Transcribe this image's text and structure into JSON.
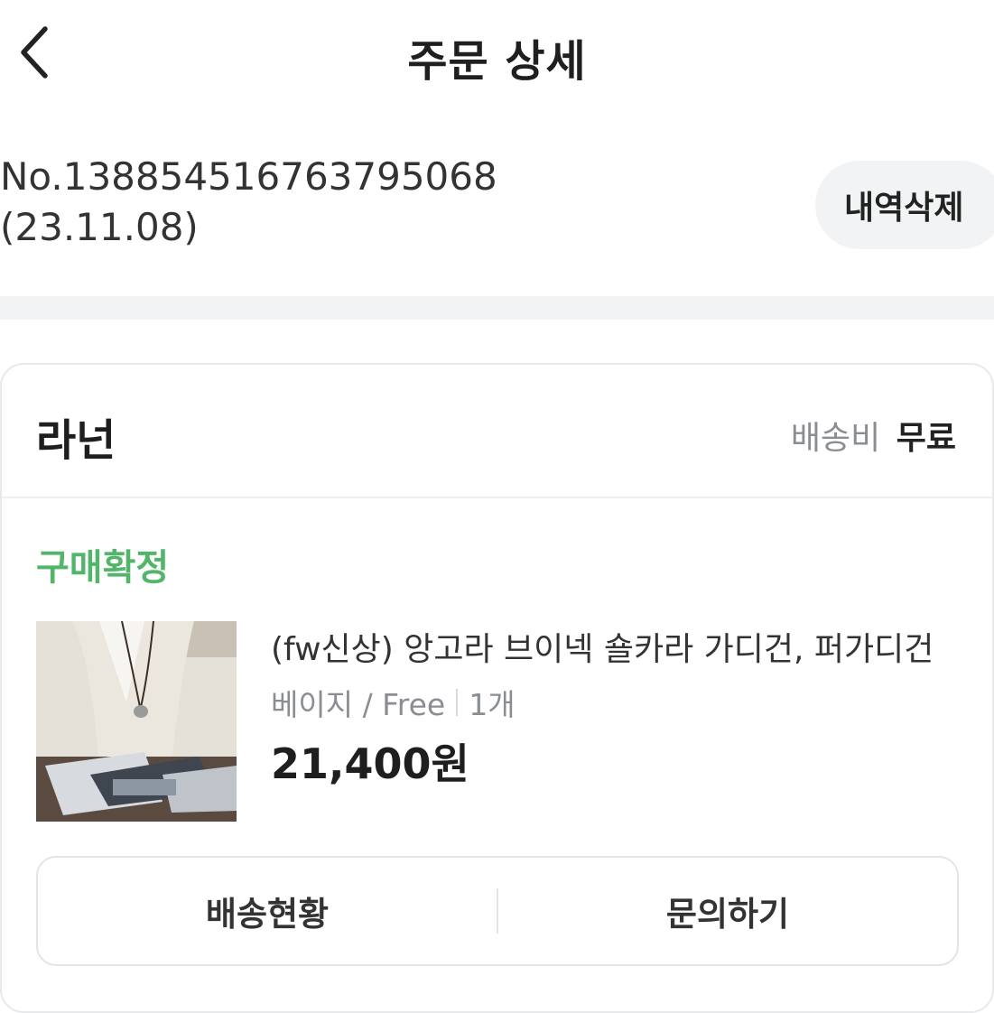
{
  "header": {
    "title": "주문 상세",
    "back_icon": "chevron-left-icon"
  },
  "order": {
    "number": "No.13885451676379506​8",
    "date": "(23.11.08)",
    "delete_label": "내역삭제"
  },
  "seller": {
    "name": "라넌",
    "shipping_label": "배송비",
    "shipping_value": "무료"
  },
  "item": {
    "status": "구매확정",
    "status_color": "#52b56a",
    "name": "(fw신상) 앙고라 브이넥 숄카라 가디건, 퍼가디건",
    "option": "베이지 / Free",
    "quantity": "1개",
    "price": "21,400원"
  },
  "actions": {
    "delivery_label": "배송현황",
    "inquiry_label": "문의하기"
  }
}
